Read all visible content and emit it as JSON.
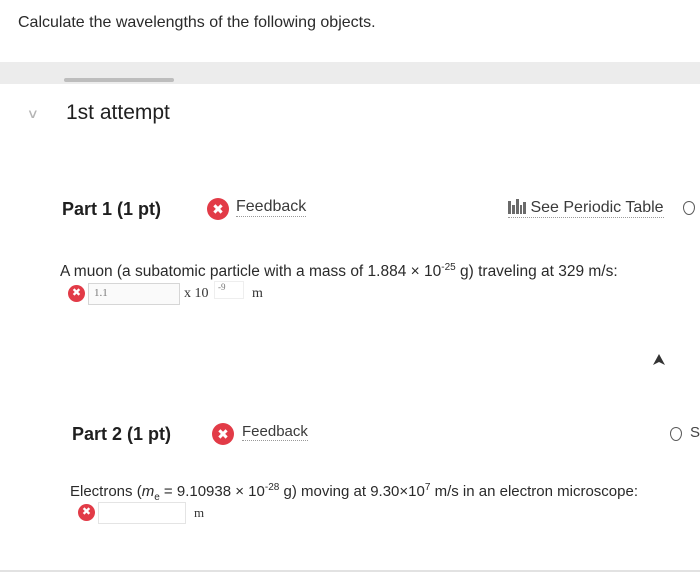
{
  "page": {
    "title": "Calculate the wavelengths of the following objects."
  },
  "attempt": {
    "label": "1st attempt"
  },
  "part1": {
    "title": "Part 1",
    "points": "(1 pt)",
    "feedback_label": "Feedback",
    "periodic_table_label": "See Periodic Table",
    "question_prefix": "A muon (a subatomic particle with a mass of 1.884 × 10",
    "question_exp": "-25",
    "question_suffix": " g) traveling at 329 m/s:",
    "answer_value": "1.1",
    "multiplier": "x 10",
    "exponent": "-9",
    "unit": "m"
  },
  "part2": {
    "title": "Part 2",
    "points": "(1 pt)",
    "feedback_label": "Feedback",
    "question_prefix": "Electrons (",
    "mass_symbol": "m",
    "mass_sub": "e",
    "question_mid": " = 9.10938 × 10",
    "question_exp1": "-28",
    "question_mid2": " g) moving at 9.30×10",
    "question_exp2": "7",
    "question_suffix": " m/s in an electron microscope:",
    "answer_value": "",
    "unit": "m",
    "hint_partial": "S"
  },
  "colors": {
    "error_red": "#e23b47",
    "band_gray": "#ececec"
  },
  "icons": {
    "incorrect": "x-circle-icon",
    "periodic_table": "periodic-table-icon",
    "hint": "hint-bulb-icon",
    "collapse": "chevron-down-icon",
    "cursor": "mouse-cursor-icon"
  }
}
